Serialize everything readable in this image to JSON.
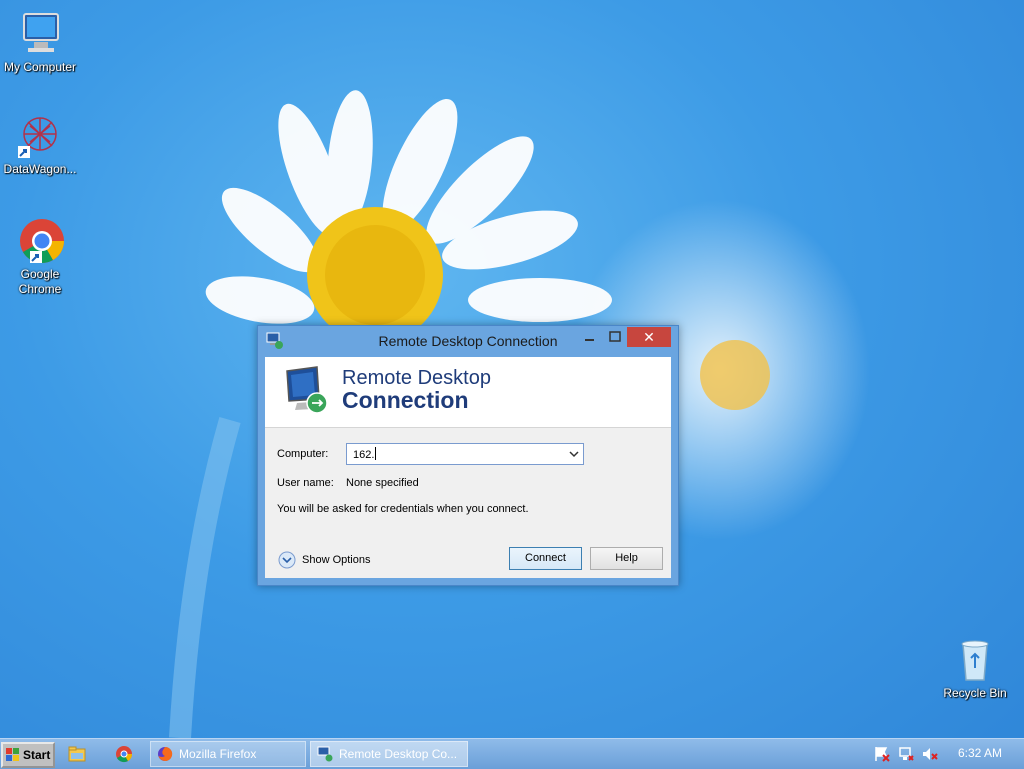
{
  "desktop": {
    "icons": [
      {
        "label": "My Computer",
        "icon": "computer-icon"
      },
      {
        "label": "DataWagon...",
        "icon": "datawagon-icon"
      },
      {
        "label_line1": "Google",
        "label_line2": "Chrome",
        "icon": "chrome-icon"
      },
      {
        "label": "Recycle Bin",
        "icon": "recycle-bin-icon"
      }
    ]
  },
  "dialog": {
    "title": "Remote Desktop Connection",
    "banner_line1": "Remote Desktop",
    "banner_line2": "Connection",
    "computer_label": "Computer:",
    "computer_value": "162.",
    "username_label": "User name:",
    "username_value": "None specified",
    "credentials_note": "You will be asked for credentials when you connect.",
    "show_options_label": "Show Options",
    "connect_label": "Connect",
    "help_label": "Help",
    "close_glyph": "✕",
    "accent_color": "#1f3c7a"
  },
  "taskbar": {
    "start_label": "Start",
    "tasks": [
      {
        "label": "Mozilla Firefox",
        "icon": "firefox-icon"
      },
      {
        "label": "Remote Desktop Co...",
        "icon": "remote-desktop-icon"
      }
    ],
    "clock": "6:32 AM"
  }
}
